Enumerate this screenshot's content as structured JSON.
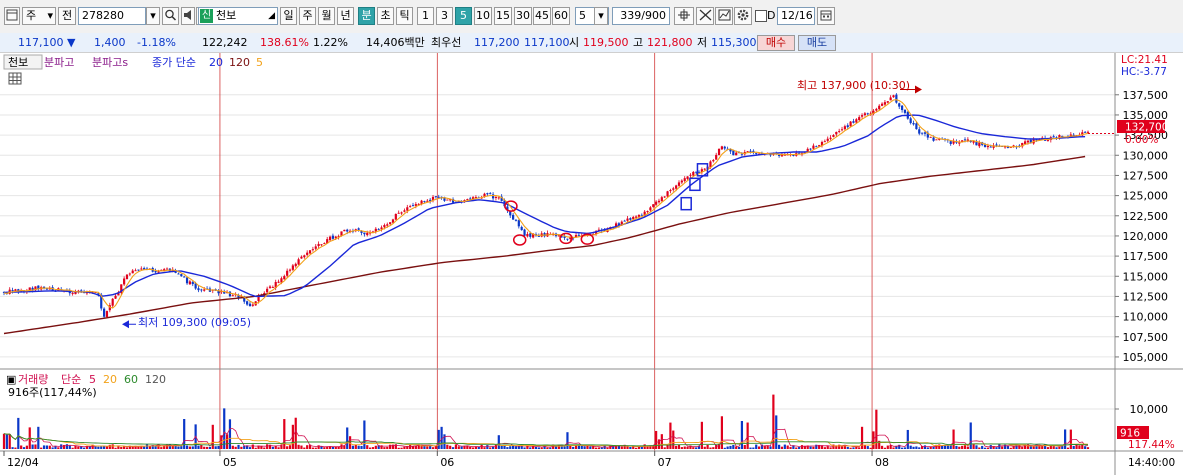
{
  "toolbar": {
    "type_select": "주",
    "prev_label": "전",
    "code": "278280",
    "name_tag": "신",
    "name": "천보",
    "periods": [
      "일",
      "주",
      "월",
      "년",
      "분",
      "초",
      "틱"
    ],
    "active_period": "분",
    "minutes": [
      "1",
      "3",
      "5",
      "10",
      "15",
      "30",
      "45",
      "60"
    ],
    "active_minute": "5",
    "custom_minute": "5",
    "count": "339/900",
    "d_label": "D",
    "date": "12/16"
  },
  "quote": {
    "price": "117,100",
    "change": "1,400",
    "change_pct": "-1.18%",
    "volume": "122,242",
    "volume_ratio": "138.61%",
    "turnover_pct": "1.22%",
    "amount": "14,406백만",
    "best_label": "최우선",
    "best_ask": "117,200",
    "best_bid": "117,100",
    "open_label": "시",
    "open": "119,500",
    "high_label": "고",
    "high": "121,800",
    "low_label": "저",
    "low": "115,300",
    "buy_label": "매수",
    "sell_label": "매도"
  },
  "colors": {
    "up": "#e0001c",
    "down": "#0a37c8",
    "ma5": "#f2a21a",
    "ma20": "#1a28d8",
    "ma120": "#7a1010",
    "volume_ma60": "#2c8a2c",
    "grid": "#e6e6e6"
  },
  "chart_data": [
    {
      "type": "candlestick",
      "legend": {
        "name": "천보",
        "items": [
          "분파고",
          "분파고s",
          "종가 단순",
          "20",
          "120",
          "5"
        ]
      },
      "y_ticks": [
        "137,500",
        "135,000",
        "132,500",
        "130,000",
        "127,500",
        "125,000",
        "122,500",
        "120,000",
        "117,500",
        "115,000",
        "112,500",
        "110,000",
        "107,500",
        "105,000"
      ],
      "ylim": [
        104000,
        140200
      ],
      "x_ticks": [
        "12/04",
        "05",
        "06",
        "07",
        "08"
      ],
      "session_candles": 76,
      "n_candles": 380,
      "current_price": "132,700",
      "current_price_value": 132700,
      "current_price_pct": "0.00%",
      "lc_label": "LC:21.41",
      "hc_label": "HC:-3.77",
      "high_annotation": {
        "text": "최고 137,900 (10:30)",
        "value": 137900
      },
      "low_annotation": {
        "text": "최저 109,300 (09:05)",
        "value": 109300
      },
      "close_path": [
        [
          0,
          113000
        ],
        [
          25,
          113500
        ],
        [
          50,
          113200
        ],
        [
          60,
          113000
        ],
        [
          76,
          112800
        ],
        [
          78,
          110500
        ],
        [
          79,
          109800
        ],
        [
          85,
          111500
        ],
        [
          90,
          112800
        ],
        [
          96,
          114800
        ],
        [
          104,
          115800
        ],
        [
          125,
          115600
        ],
        [
          135,
          115800
        ],
        [
          145,
          114500
        ],
        [
          155,
          113500
        ],
        [
          175,
          113000
        ],
        [
          190,
          112300
        ],
        [
          196,
          111400
        ],
        [
          200,
          111800
        ],
        [
          204,
          112500
        ],
        [
          214,
          113700
        ],
        [
          232,
          116500
        ],
        [
          248,
          118500
        ],
        [
          262,
          119800
        ],
        [
          275,
          120800
        ],
        [
          290,
          120300
        ],
        [
          300,
          120800
        ],
        [
          315,
          122800
        ],
        [
          330,
          124000
        ],
        [
          345,
          124800
        ],
        [
          360,
          124300
        ],
        [
          378,
          124700
        ],
        [
          385,
          125200
        ],
        [
          397,
          124500
        ],
        [
          405,
          122300
        ],
        [
          412,
          121200
        ],
        [
          416,
          120000
        ],
        [
          430,
          120200
        ],
        [
          450,
          119800
        ],
        [
          468,
          120200
        ],
        [
          480,
          120800
        ],
        [
          495,
          121800
        ],
        [
          510,
          122800
        ],
        [
          525,
          124500
        ],
        [
          538,
          126500
        ],
        [
          548,
          127800
        ],
        [
          560,
          128200
        ],
        [
          566,
          129500
        ],
        [
          573,
          131000
        ],
        [
          582,
          130200
        ],
        [
          594,
          130300
        ],
        [
          610,
          130100
        ],
        [
          627,
          130000
        ],
        [
          640,
          130500
        ],
        [
          652,
          131500
        ],
        [
          662,
          132500
        ],
        [
          672,
          133500
        ],
        [
          685,
          134800
        ],
        [
          697,
          135800
        ],
        [
          706,
          136700
        ],
        [
          711,
          137300
        ],
        [
          715,
          136200
        ],
        [
          722,
          134500
        ],
        [
          730,
          133000
        ],
        [
          738,
          132300
        ],
        [
          746,
          131800
        ],
        [
          756,
          131600
        ],
        [
          768,
          131800
        ],
        [
          782,
          131300
        ],
        [
          794,
          131100
        ],
        [
          804,
          131000
        ],
        [
          816,
          131600
        ],
        [
          826,
          131900
        ],
        [
          840,
          132200
        ],
        [
          850,
          132400
        ],
        [
          858,
          132600
        ],
        [
          866,
          132700
        ]
      ],
      "ma20_path": [
        [
          0,
          113000
        ],
        [
          40,
          113200
        ],
        [
          70,
          113000
        ],
        [
          78,
          112500
        ],
        [
          90,
          112800
        ],
        [
          105,
          114300
        ],
        [
          120,
          115300
        ],
        [
          140,
          115700
        ],
        [
          160,
          115000
        ],
        [
          180,
          113900
        ],
        [
          200,
          112500
        ],
        [
          225,
          112600
        ],
        [
          240,
          113700
        ],
        [
          260,
          116200
        ],
        [
          280,
          119000
        ],
        [
          300,
          120000
        ],
        [
          320,
          121600
        ],
        [
          340,
          123400
        ],
        [
          360,
          124100
        ],
        [
          380,
          124500
        ],
        [
          400,
          124100
        ],
        [
          420,
          122500
        ],
        [
          440,
          121000
        ],
        [
          450,
          120500
        ],
        [
          468,
          120300
        ],
        [
          490,
          121200
        ],
        [
          510,
          122200
        ],
        [
          530,
          123800
        ],
        [
          550,
          126500
        ],
        [
          570,
          128700
        ],
        [
          590,
          129800
        ],
        [
          610,
          130200
        ],
        [
          630,
          130400
        ],
        [
          650,
          130400
        ],
        [
          670,
          131100
        ],
        [
          690,
          132400
        ],
        [
          700,
          133500
        ],
        [
          715,
          134900
        ],
        [
          730,
          135000
        ],
        [
          745,
          134300
        ],
        [
          760,
          133500
        ],
        [
          780,
          132700
        ],
        [
          800,
          132300
        ],
        [
          820,
          132000
        ],
        [
          840,
          132100
        ],
        [
          860,
          132300
        ]
      ],
      "ma120_path": [
        [
          0,
          107900
        ],
        [
          60,
          109300
        ],
        [
          100,
          110300
        ],
        [
          150,
          111700
        ],
        [
          200,
          112500
        ],
        [
          250,
          114000
        ],
        [
          300,
          115500
        ],
        [
          350,
          116700
        ],
        [
          400,
          117500
        ],
        [
          440,
          118300
        ],
        [
          470,
          118800
        ],
        [
          500,
          119800
        ],
        [
          540,
          121500
        ],
        [
          580,
          122900
        ],
        [
          620,
          124000
        ],
        [
          660,
          125100
        ],
        [
          700,
          126500
        ],
        [
          740,
          127400
        ],
        [
          780,
          128100
        ],
        [
          820,
          128800
        ],
        [
          866,
          129900
        ]
      ],
      "markers": {
        "circles": [
          {
            "candle": 405,
            "value": 123700
          },
          {
            "candle": 412,
            "value": 119500
          },
          {
            "candle": 449,
            "value": 119700
          },
          {
            "candle": 466,
            "value": 119600
          }
        ],
        "boxes": [
          {
            "candle": 545,
            "value": 124000
          },
          {
            "candle": 552,
            "value": 126400
          },
          {
            "candle": 558,
            "value": 128200
          }
        ]
      }
    },
    {
      "type": "bar",
      "title": "거래량",
      "legend": [
        "단순",
        "5",
        "20",
        "60",
        "120"
      ],
      "volume_label": "916주(117,44%)",
      "y_ticks": [
        "10,000"
      ],
      "ylim": [
        0,
        14500
      ],
      "current_volume": "916",
      "current_volume_value": 916,
      "current_volume_pct": "117.44%",
      "time_label": "14:40:00"
    }
  ]
}
